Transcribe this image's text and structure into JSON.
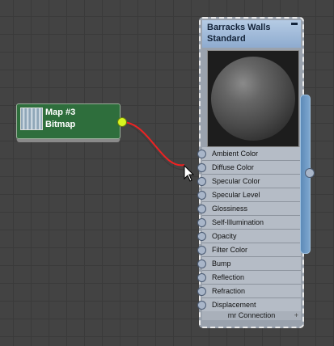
{
  "bitmap_node": {
    "title": "Map #3",
    "type": "Bitmap"
  },
  "material_node": {
    "title": "Barracks Walls",
    "type": "Standard",
    "slots": [
      "Ambient Color",
      "Diffuse Color",
      "Specular Color",
      "Specular Level",
      "Glossiness",
      "Self-Illumination",
      "Opacity",
      "Filter Color",
      "Bump",
      "Reflection",
      "Refraction",
      "Displacement"
    ],
    "footer": "mr Connection",
    "footer_plus": "+"
  },
  "colors": {
    "bitmap_node_bg": "#2e6e3c",
    "material_header_bg": "#9db8d8",
    "wire": "#ee2222",
    "output_socket": "#d7f520"
  }
}
